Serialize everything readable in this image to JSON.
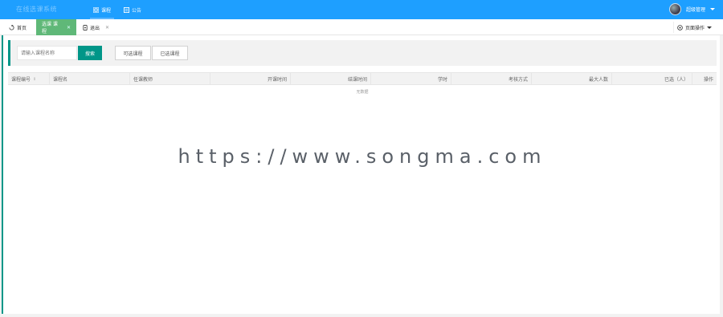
{
  "topbar": {
    "brand": "在线选课系统",
    "nav": [
      {
        "label": "课程",
        "icon": "grid-icon",
        "active": true
      },
      {
        "label": "公告",
        "icon": "notice-icon",
        "active": false
      }
    ],
    "user_name": "超级管理"
  },
  "tabs": [
    {
      "label": "首页",
      "icon": "home-icon",
      "active": false,
      "closable": false
    },
    {
      "label": "选课 课程",
      "icon": "",
      "active": true,
      "closable": true
    },
    {
      "label": "退出",
      "icon": "exit-icon",
      "active": false,
      "closable": true
    }
  ],
  "page_ops_label": "页面操作",
  "toolbar": {
    "search_placeholder": "请输入课程名称",
    "search_button": "搜索",
    "selectable_button": "可选课程",
    "selected_button": "已选课程"
  },
  "table": {
    "columns": [
      {
        "label": "课程编号",
        "sortable": true,
        "align": "left"
      },
      {
        "label": "课程名",
        "sortable": false,
        "align": "left"
      },
      {
        "label": "任课教师",
        "sortable": false,
        "align": "left"
      },
      {
        "label": "开课时间",
        "sortable": false,
        "align": "right"
      },
      {
        "label": "结课时间",
        "sortable": false,
        "align": "right"
      },
      {
        "label": "学时",
        "sortable": false,
        "align": "right"
      },
      {
        "label": "考核方式",
        "sortable": false,
        "align": "right"
      },
      {
        "label": "最大人数",
        "sortable": false,
        "align": "right"
      },
      {
        "label": "已选（人）",
        "sortable": false,
        "align": "right"
      },
      {
        "label": "操作",
        "sortable": false,
        "align": "right"
      }
    ],
    "empty_text": "无数据"
  },
  "watermark": "https://www.songma.com",
  "colors": {
    "header": "#1e9fff",
    "active_tab": "#5fb878",
    "primary_button": "#009688"
  }
}
